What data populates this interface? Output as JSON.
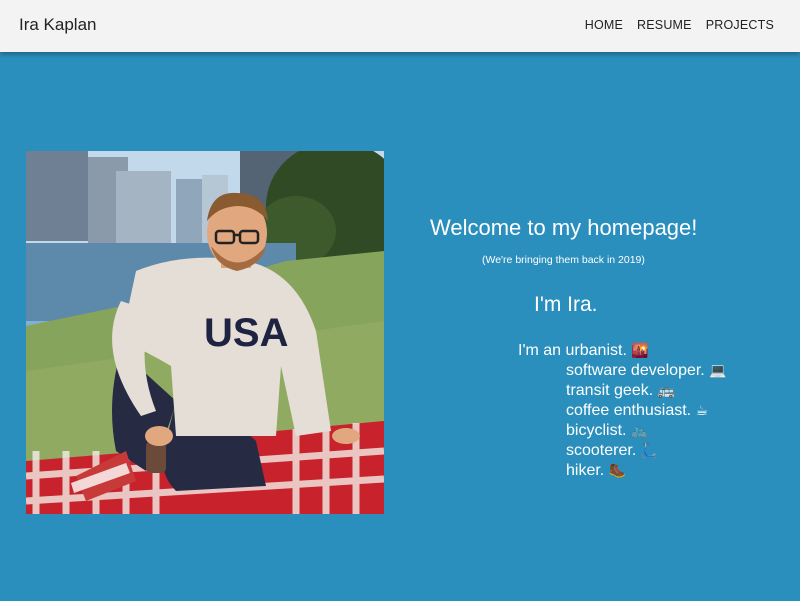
{
  "header": {
    "brand": "Ira Kaplan",
    "nav": [
      {
        "label": "HOME"
      },
      {
        "label": "RESUME"
      },
      {
        "label": "PROJECTS"
      }
    ]
  },
  "main": {
    "welcome": "Welcome to my homepage!",
    "subtitle": "(We're bringing them back in 2019)",
    "intro": "I'm Ira.",
    "prefix": "I'm an",
    "roles": [
      {
        "text": "urbanist.",
        "emoji": "🌇"
      },
      {
        "text": "software developer.",
        "emoji": "💻"
      },
      {
        "text": "transit geek.",
        "emoji": "🚌"
      },
      {
        "text": "coffee enthusiast.",
        "emoji": "☕"
      },
      {
        "text": "bicyclist.",
        "emoji": "🚲"
      },
      {
        "text": "scooterer.",
        "emoji": "🛴"
      },
      {
        "text": "hiker.",
        "emoji": "🥾"
      }
    ]
  },
  "photo": {
    "shirt_text": "USA",
    "colors": {
      "sky": "#b9d4ea",
      "water": "#5a86a8",
      "grass": "#7d9a52",
      "blanket_red": "#c8232c",
      "shirt": "#e6e0d8",
      "jeans": "#252a40"
    }
  }
}
